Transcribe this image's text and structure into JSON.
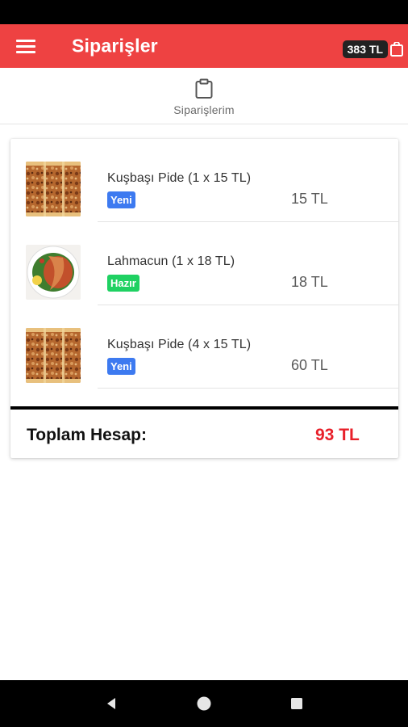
{
  "app_bar": {
    "title": "Siparişler",
    "cart_total": "383 TL",
    "accent_color": "#ee4242"
  },
  "tab": {
    "label": "Siparişlerim",
    "icon": "clipboard-icon"
  },
  "orders": [
    {
      "name": "Kuşbaşı Pide (1 x 15 TL)",
      "status": "Yeni",
      "status_color": "#3d7af0",
      "price": "15 TL",
      "image": "kusbasi-pide-photo"
    },
    {
      "name": "Lahmacun (1 x 18 TL)",
      "status": "Hazır",
      "status_color": "#1fd162",
      "price": "18 TL",
      "image": "lahmacun-photo"
    },
    {
      "name": "Kuşbaşı Pide (4 x 15 TL)",
      "status": "Yeni",
      "status_color": "#3d7af0",
      "price": "60 TL",
      "image": "kusbasi-pide-photo"
    }
  ],
  "total": {
    "label": "Toplam Hesap:",
    "value": "93 TL",
    "value_color": "#e8202a"
  },
  "nav": {
    "back": "back-triangle-icon",
    "home": "home-circle-icon",
    "recents": "recents-square-icon"
  }
}
